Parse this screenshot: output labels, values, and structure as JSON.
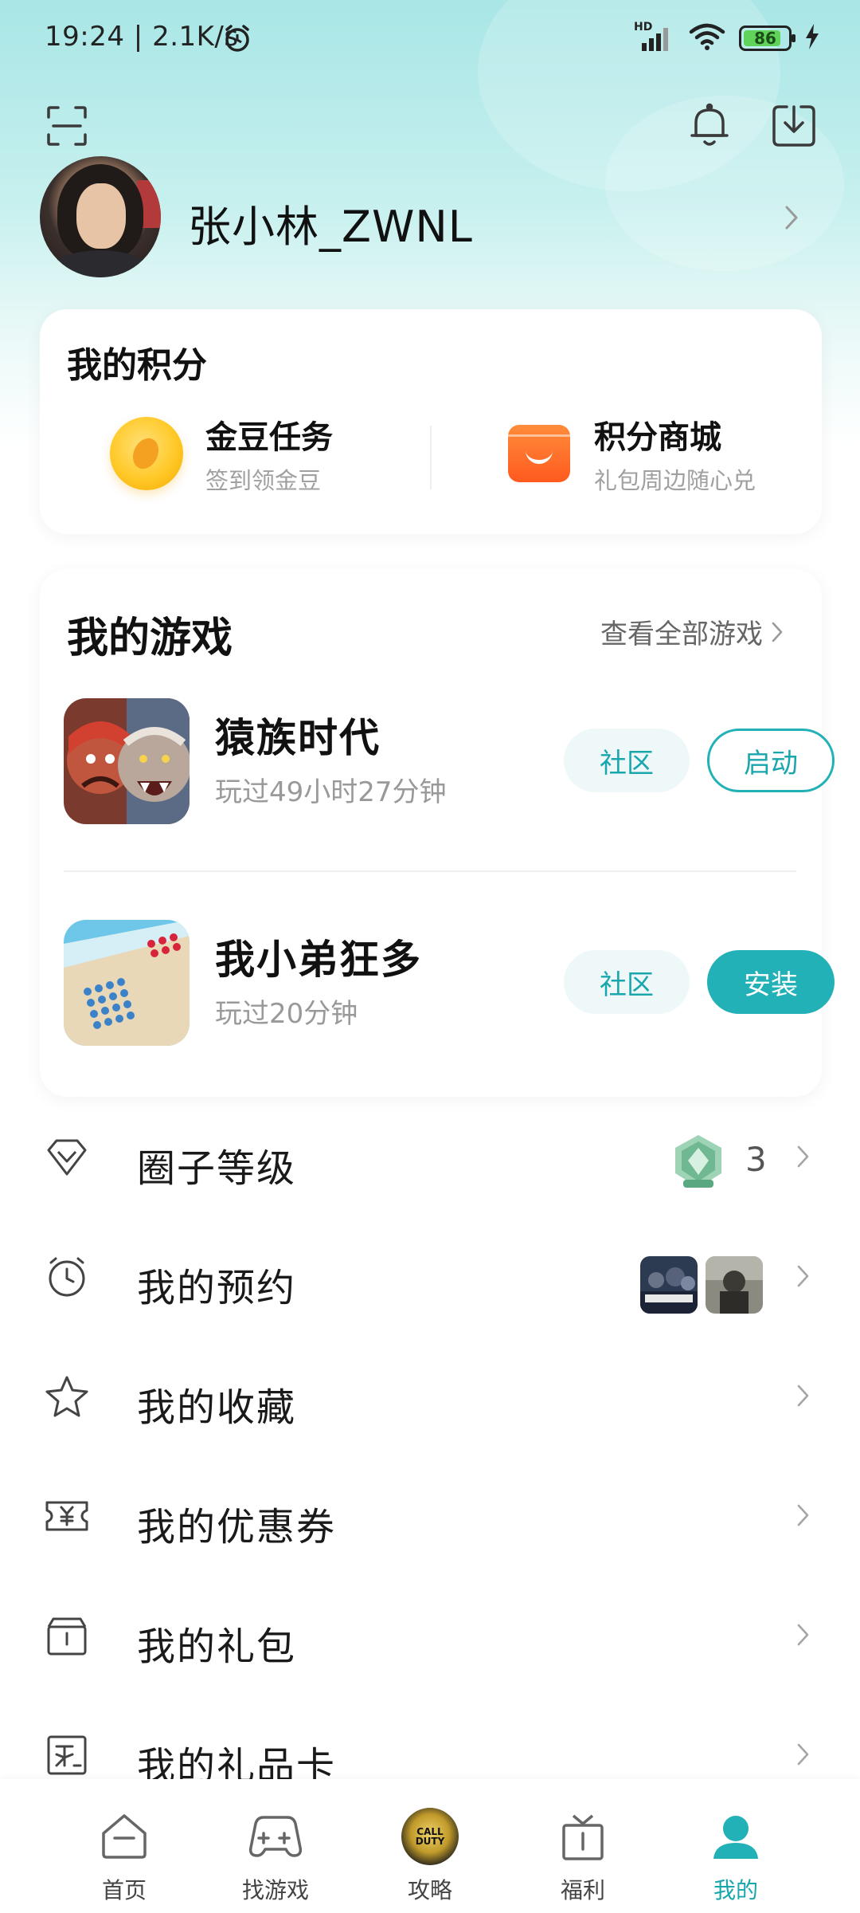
{
  "status_bar": {
    "time": "19:24",
    "speed": "2.1K/s",
    "signal_label": "HD",
    "battery_level": 86,
    "battery_text": "86",
    "icons": [
      "alarm-icon",
      "signal-icon",
      "wifi-icon",
      "battery-icon",
      "charging-icon"
    ]
  },
  "header": {
    "icons": [
      "scan-icon",
      "bell-icon",
      "download-icon"
    ]
  },
  "profile": {
    "username": "张小林_ZWNL"
  },
  "points": {
    "title": "我的积分",
    "items": [
      {
        "title": "金豆任务",
        "subtitle": "签到领金豆",
        "icon": "gold-bean-icon"
      },
      {
        "title": "积分商城",
        "subtitle": "礼包周边随心兑",
        "icon": "shop-bag-icon"
      }
    ]
  },
  "games": {
    "title": "我的游戏",
    "view_all": "查看全部游戏",
    "list": [
      {
        "name": "猿族时代",
        "playtime": "玩过49小时27分钟",
        "community": "社区",
        "action": "启动"
      },
      {
        "name": "我小弟狂多",
        "playtime": "玩过20分钟",
        "community": "社区",
        "action": "安装"
      }
    ]
  },
  "menu": [
    {
      "label": "圈子等级",
      "icon": "diamond-icon",
      "value": "3"
    },
    {
      "label": "我的预约",
      "icon": "alarm-clock-icon"
    },
    {
      "label": "我的收藏",
      "icon": "star-icon"
    },
    {
      "label": "我的优惠券",
      "icon": "coupon-icon"
    },
    {
      "label": "我的礼包",
      "icon": "gift-box-icon"
    },
    {
      "label": "我的礼品卡",
      "icon": "gift-card-icon"
    }
  ],
  "bottom_nav": [
    {
      "label": "首页",
      "icon": "home-icon"
    },
    {
      "label": "找游戏",
      "icon": "gamepad-icon"
    },
    {
      "label": "攻略",
      "icon": "game-avatar-icon"
    },
    {
      "label": "福利",
      "icon": "gift-icon"
    },
    {
      "label": "我的",
      "icon": "profile-icon",
      "active": true
    }
  ],
  "colors": {
    "accent": "#22b1b6",
    "header_gradient_top": "#a9e6e6",
    "coin": "#ffc928",
    "shop": "#ff6a25"
  }
}
